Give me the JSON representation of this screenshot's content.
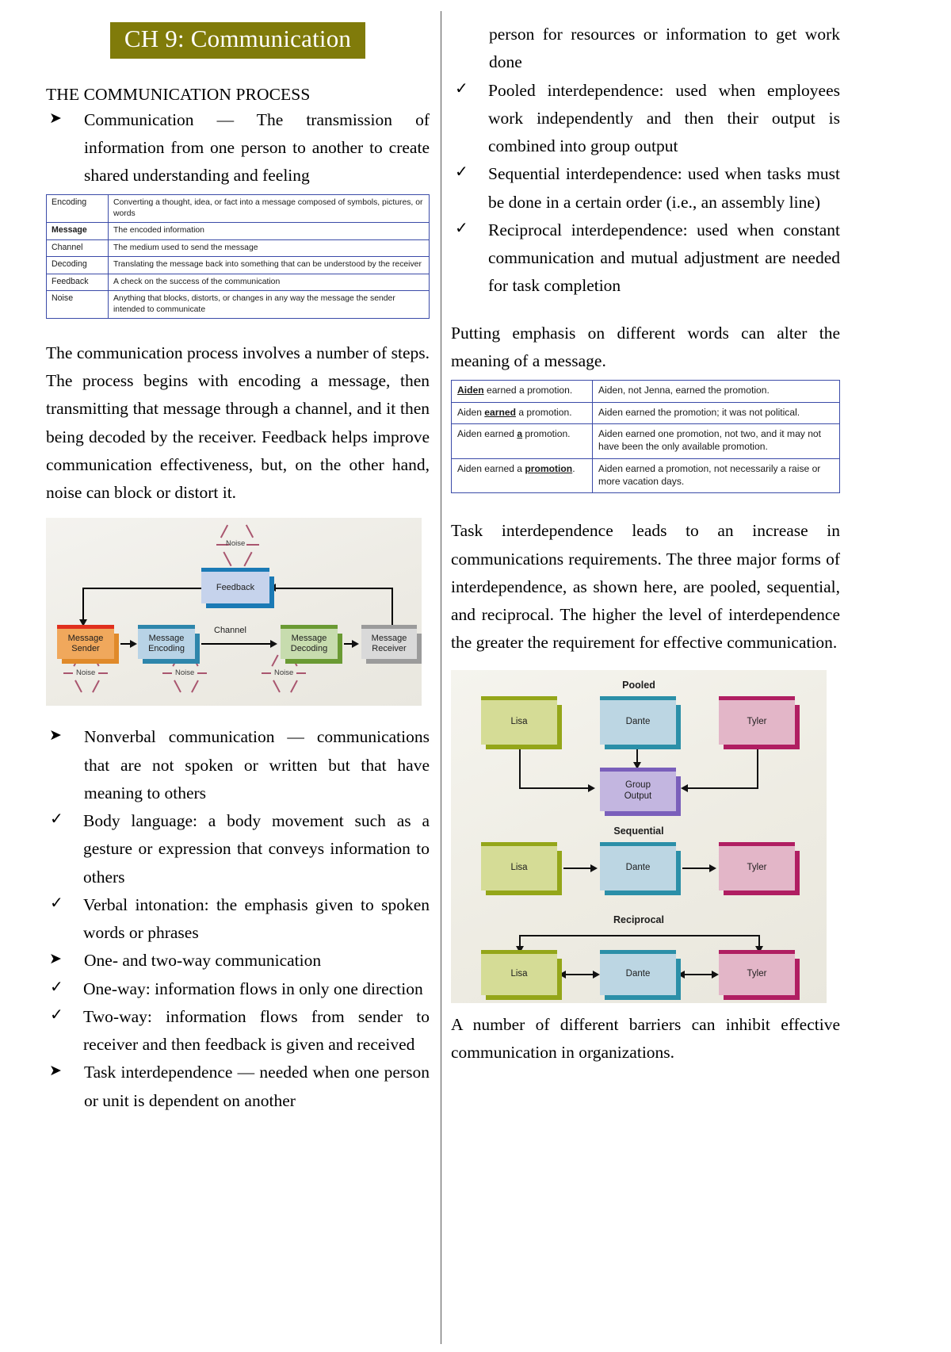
{
  "document": {
    "title": "CH 9: Communication",
    "title_band_color": "#807b0a"
  },
  "left_column": {
    "section_heading": "THE COMMUNICATION PROCESS",
    "bullet_communication": "Communication — The transmission of information from one person to another to create shared understanding and feeling",
    "process_table": {
      "rows": [
        {
          "term": "Encoding",
          "bold": false,
          "definition": "Converting a thought, idea, or fact into a message composed of symbols, pictures, or words"
        },
        {
          "term": "Message",
          "bold": true,
          "definition": "The encoded information"
        },
        {
          "term": "Channel",
          "bold": false,
          "definition": "The medium used to send the message"
        },
        {
          "term": "Decoding",
          "bold": false,
          "definition": "Translating the message back into something that can be understood by the receiver"
        },
        {
          "term": "Feedback",
          "bold": false,
          "definition": "A check on the success of the communication"
        },
        {
          "term": "Noise",
          "bold": false,
          "definition": "Anything that blocks, distorts, or changes in any way the message the sender intended to communicate"
        }
      ]
    },
    "paragraph_process": "The communication process involves a number of steps. The process begins with encoding a message, then transmitting that message through a channel, and it then being decoded by the receiver. Feedback helps improve communication effectiveness, but, on the other hand, noise can block or distort it.",
    "figure_communication": {
      "boxes": {
        "sender": "Message\nSender",
        "sender_l1": "Message",
        "sender_l2": "Sender",
        "encoding_l1": "Message",
        "encoding_l2": "Encoding",
        "decoding_l1": "Message",
        "decoding_l2": "Decoding",
        "receiver_l1": "Message",
        "receiver_l2": "Receiver",
        "feedback": "Feedback"
      },
      "channel_label": "Channel",
      "noise_labels": [
        "Noise",
        "Noise",
        "Noise",
        "Noise"
      ]
    },
    "bullet_nonverbal": "Nonverbal communication — communications that are not spoken or written but that have meaning to others",
    "nonverbal_subitems": [
      "Body language: a body movement such as a gesture or expression that conveys information to others",
      "Verbal intonation: the emphasis given to spoken words or phrases"
    ],
    "bullet_oneway": "One- and two-way communication",
    "oneway_subitems": [
      "One-way: information flows in only one direction",
      "Two-way: information flows from sender to receiver and then feedback is given and received"
    ],
    "bullet_task": "Task interdependence — needed when one person or unit is dependent on another"
  },
  "right_column": {
    "continuation_text": "person for resources or information to get work done",
    "interdependence_subitems": [
      "Pooled interdependence: used when employees work independently and then their output is combined into group output",
      "Sequential interdependence: used when tasks must be done in a certain order (i.e., an assembly line)",
      "Reciprocal interdependence: used when constant communication and mutual adjustment are needed for task completion"
    ],
    "paragraph_emphasis": "Putting emphasis on different words can alter the meaning of a message.",
    "emphasis_table": {
      "rows": [
        {
          "sentence_pre": "",
          "sentence_bold": "Aiden",
          "sentence_post": " earned a promotion.",
          "meaning": "Aiden, not Jenna, earned the promotion."
        },
        {
          "sentence_pre": "Aiden ",
          "sentence_bold": "earned",
          "sentence_post": " a promotion.",
          "meaning": "Aiden earned the promotion; it was not political."
        },
        {
          "sentence_pre": "Aiden earned ",
          "sentence_bold": "a",
          "sentence_post": " promotion.",
          "meaning": "Aiden earned one promotion, not two, and it may not have been the only available promotion."
        },
        {
          "sentence_pre": "Aiden earned a ",
          "sentence_bold": "promotion",
          "sentence_post": ".",
          "meaning": "Aiden earned a promotion, not necessarily a raise or more vacation days."
        }
      ]
    },
    "paragraph_task": "Task interdependence leads to an increase in communications requirements. The three major forms of interdependence, as shown here, are pooled, sequential, and reciprocal. The higher the level of interdependence the greater the requirement for effective communication.",
    "figure_interdependence": {
      "sections": [
        "Pooled",
        "Sequential",
        "Reciprocal"
      ],
      "names": {
        "lisa": "Lisa",
        "dante": "Dante",
        "tyler": "Tyler"
      },
      "group_output_l1": "Group",
      "group_output_l2": "Output"
    },
    "paragraph_barriers": "A number of different barriers can inhibit effective communication in organizations."
  }
}
